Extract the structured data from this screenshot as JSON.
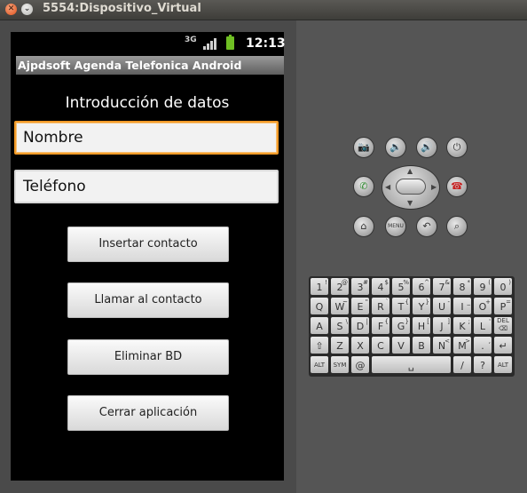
{
  "window": {
    "title": "5554:Dispositivo_Virtual"
  },
  "statusbar": {
    "network": "3G",
    "clock": "12:13"
  },
  "app": {
    "title": "Ajpdsoft Agenda Telefonica Android",
    "intro_label": "Introducción de datos",
    "name_placeholder": "Nombre",
    "phone_placeholder": "Teléfono",
    "buttons": {
      "insert": "Insertar contacto",
      "call": "Llamar al contacto",
      "delete": "Eliminar BD",
      "close": "Cerrar aplicación"
    }
  },
  "controls": {
    "menu_label": "MENU"
  },
  "keyboard": {
    "row1": [
      [
        "Q",
        "1"
      ],
      [
        "W",
        "2"
      ],
      [
        "E",
        "3"
      ],
      [
        "R",
        "4"
      ],
      [
        "T",
        "5"
      ],
      [
        "Y",
        "6"
      ],
      [
        "U",
        "7"
      ],
      [
        "I",
        "8"
      ],
      [
        "O",
        "9"
      ],
      [
        "P",
        "0"
      ]
    ],
    "row1_top": [
      "1",
      "2",
      "3",
      "4",
      "5",
      "6",
      "7",
      "8",
      "9",
      "0"
    ],
    "row1_sub": [
      "!",
      "@",
      "#",
      "$",
      "%",
      "^",
      "&",
      "*",
      "(",
      ")"
    ],
    "row2": [
      "Q",
      "W",
      "E",
      "R",
      "T",
      "Y",
      "U",
      "I",
      "O",
      "P"
    ],
    "row2_sub": [
      "~",
      "\"",
      "`",
      "{",
      "}",
      "-",
      "_",
      "+",
      "="
    ],
    "row3": [
      "A",
      "S",
      "D",
      "F",
      "G",
      "H",
      "J",
      "K",
      "L"
    ],
    "row3_sub": [
      "\\",
      "|",
      "{",
      "}",
      "[",
      "]",
      ";",
      "'",
      ":"
    ],
    "row4": [
      "Z",
      "X",
      "C",
      "V",
      "B",
      "N",
      "M",
      "."
    ],
    "row4_sub": [
      "",
      "",
      "",
      "",
      "",
      "<",
      ">",
      ","
    ],
    "bottom": {
      "alt": "ALT",
      "sym": "SYM",
      "at": "@",
      "slash": "/",
      "question": "?",
      "del": "DEL"
    }
  }
}
